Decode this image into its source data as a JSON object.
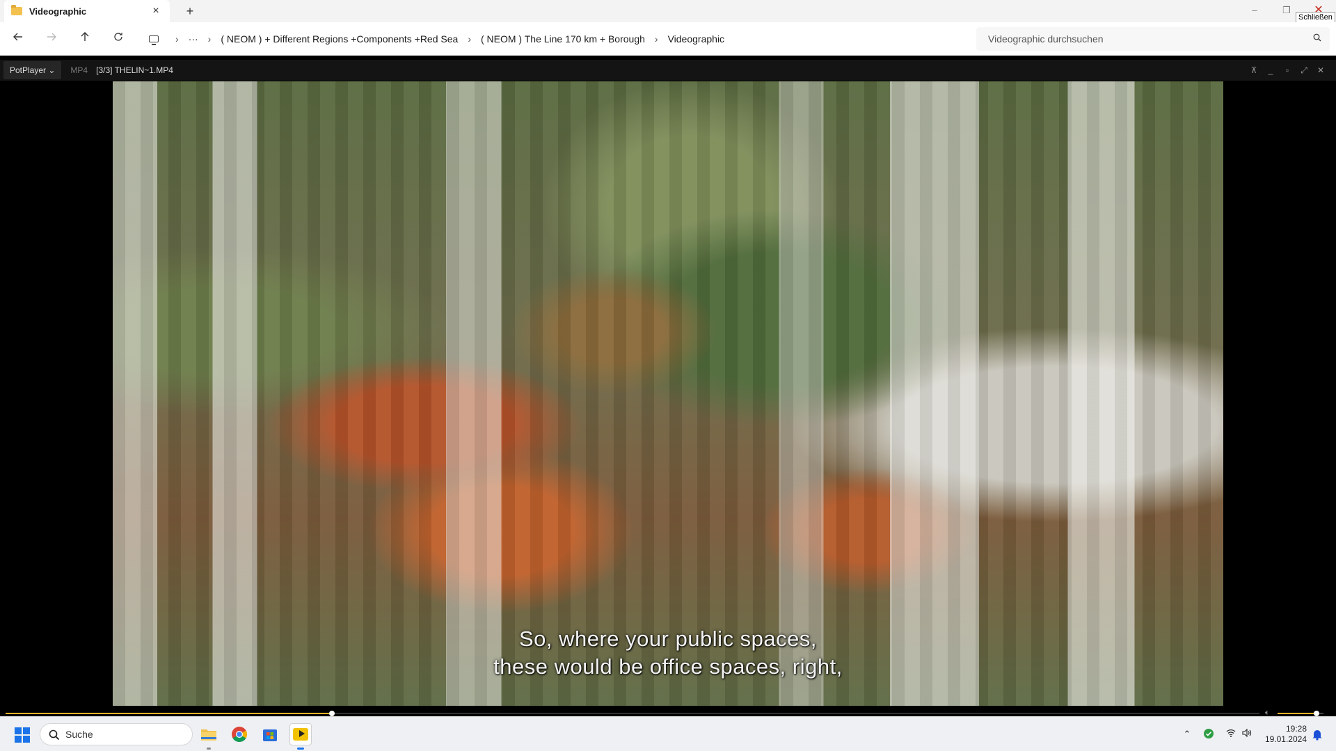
{
  "explorer": {
    "tab_title": "Videographic",
    "tab_close": "×",
    "new_tab": "+",
    "minimize": "–",
    "maximize": "❐",
    "close": "✕",
    "close_tooltip": "Schließen",
    "breadcrumb": [
      "( NEOM ) + Different Regions +Components +Red Sea",
      "( NEOM ) The Line 170 km + Borough",
      "Videographic"
    ],
    "more": "···",
    "search_placeholder": "Videographic durchsuchen"
  },
  "player": {
    "menu_label": "PotPlayer",
    "format": "MP4",
    "file_title": "[3/3] THELIN~1.MP4",
    "subtitle_line1": "So, where your public spaces,",
    "subtitle_line2": "these would be office spaces, right,",
    "progress": 0.26,
    "volume": 0.85
  },
  "taskbar": {
    "search_label": "Suche",
    "time": "19:28",
    "date": "19.01.2024"
  },
  "colors": {
    "accent_yellow": "#e8b12a",
    "windows_blue": "#1a73e8",
    "close_red": "#c42b1c"
  }
}
